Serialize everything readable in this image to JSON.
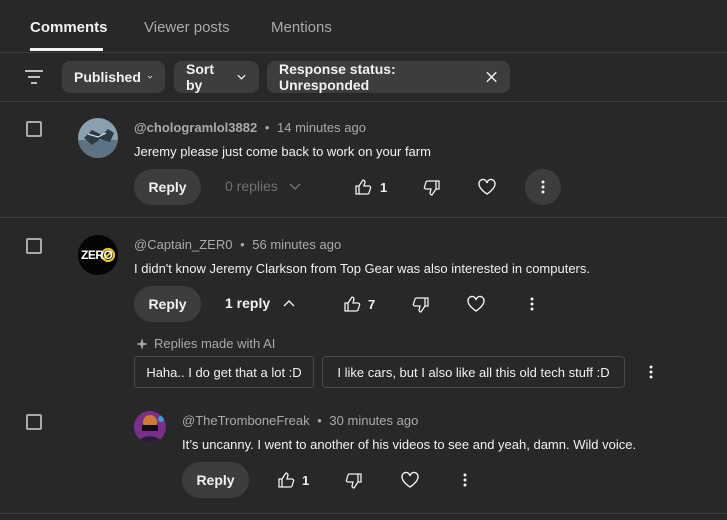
{
  "tabs": [
    {
      "label": "Comments",
      "active": true
    },
    {
      "label": "Viewer posts",
      "active": false
    },
    {
      "label": "Mentions",
      "active": false
    }
  ],
  "filters": {
    "published_label": "Published",
    "sort_label": "Sort by",
    "response_status_label": "Response status: Unresponded"
  },
  "comments": [
    {
      "author": "@chologramlol3882",
      "time": "14 minutes ago",
      "text": "Jeremy please just come back to work on your farm",
      "reply_label": "Reply",
      "replies_label": "0 replies",
      "likes": "1"
    },
    {
      "author": "@Captain_ZER0",
      "time": "56 minutes ago",
      "text": "I didn't know Jeremy Clarkson from Top Gear was also interested in computers.",
      "reply_label": "Reply",
      "replies_label": "1 reply",
      "likes": "7",
      "avatar_text": "ZERO",
      "ai_label": "Replies made with AI",
      "suggestions": [
        "Haha.. I do get that a lot :D",
        "I like cars, but I also like all this old tech stuff :D"
      ]
    },
    {
      "author": "@TheTromboneFreak",
      "time": "30 minutes ago",
      "text": "It’s uncanny. I went to another of his videos to see and yeah, damn. Wild voice.",
      "reply_label": "Reply",
      "likes": "1"
    }
  ],
  "separator": "•",
  "colors": {
    "background": "#282828",
    "chip": "#3d3d3d",
    "muted_text": "#aaaaaa",
    "divider": "#3e3e3e"
  }
}
